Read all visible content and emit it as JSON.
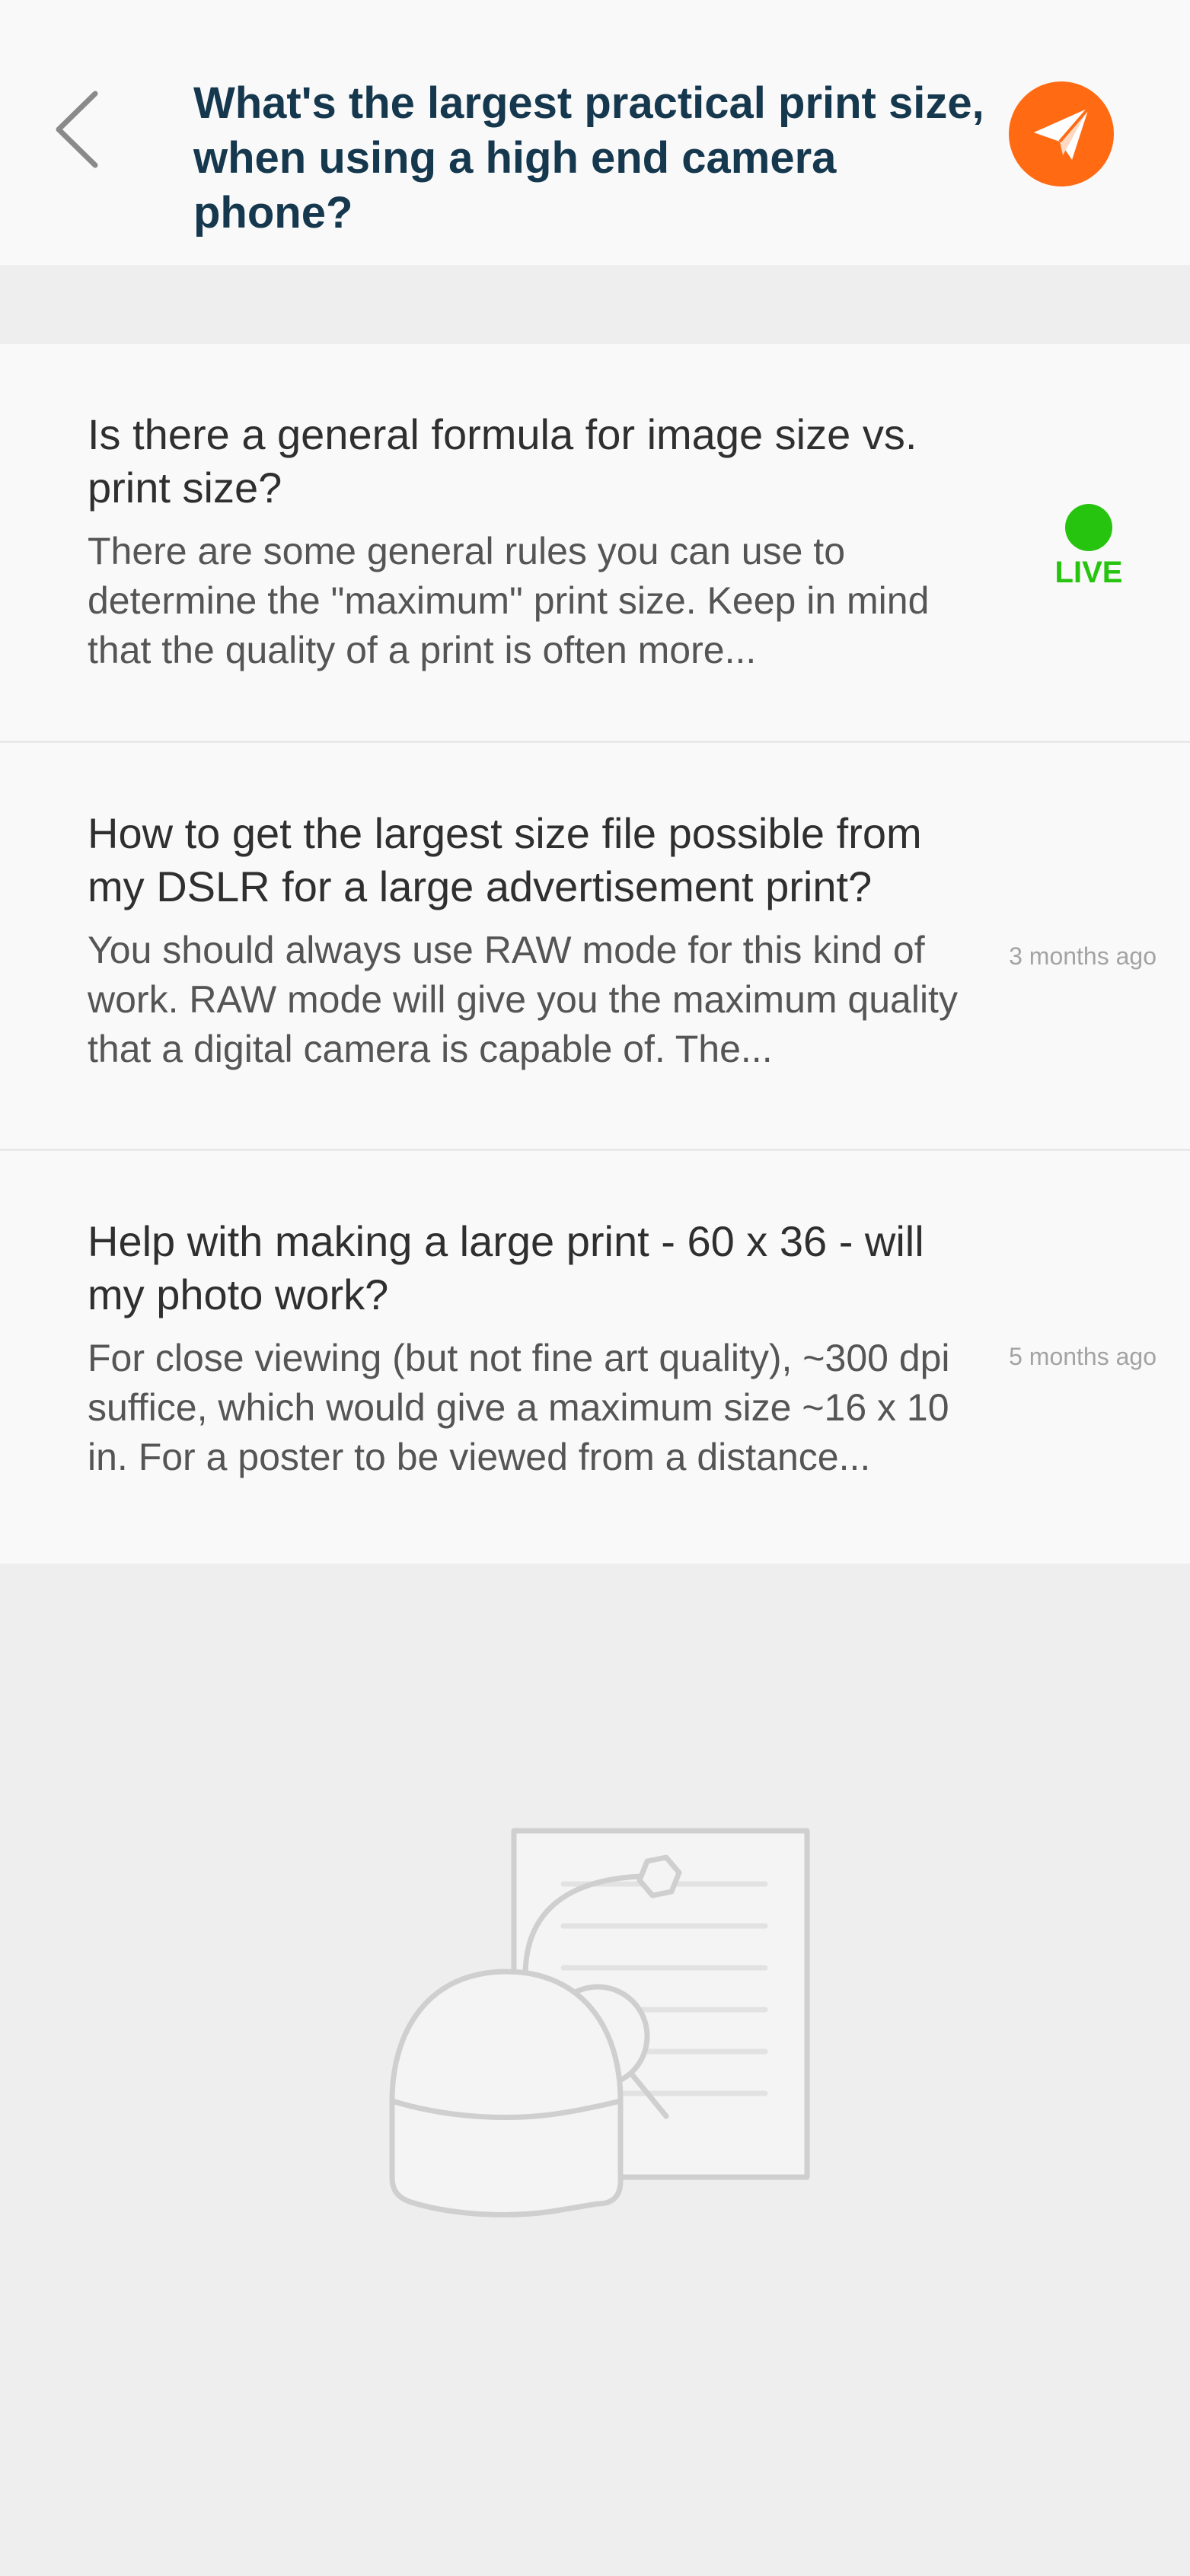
{
  "header": {
    "back_icon": "chevron-left-icon",
    "title": "What's the largest practical print size, when using a high end camera phone?",
    "send_icon": "paper-plane-icon",
    "accent_color": "#ff6a13"
  },
  "results": [
    {
      "title": "Is there a general formula for image size vs. print size?",
      "snippet": "There are some general rules you can use to determine the \"maximum\" print size. Keep in mind that the quality of a print is often more...",
      "status": "LIVE"
    },
    {
      "title": "How to get the largest size file possible from my DSLR for a large advertisement print?",
      "snippet": "You should always use RAW mode for this kind of work. RAW mode will give you the maximum quality that a digital camera is capable of. The...",
      "time": "3 months ago"
    },
    {
      "title": "Help with making a large print - 60 x 36 - will my photo work?",
      "snippet": "For close viewing (but not fine art quality), ~300 dpi suffice, which would give a maximum size ~16 x 10 in. For a poster to be viewed from a distance...",
      "time": "5 months ago"
    }
  ],
  "colors": {
    "title_text": "#15384e",
    "live_green": "#27c40f",
    "background": "#eeeeee"
  },
  "illustration_icon": "document-robot-illustration"
}
